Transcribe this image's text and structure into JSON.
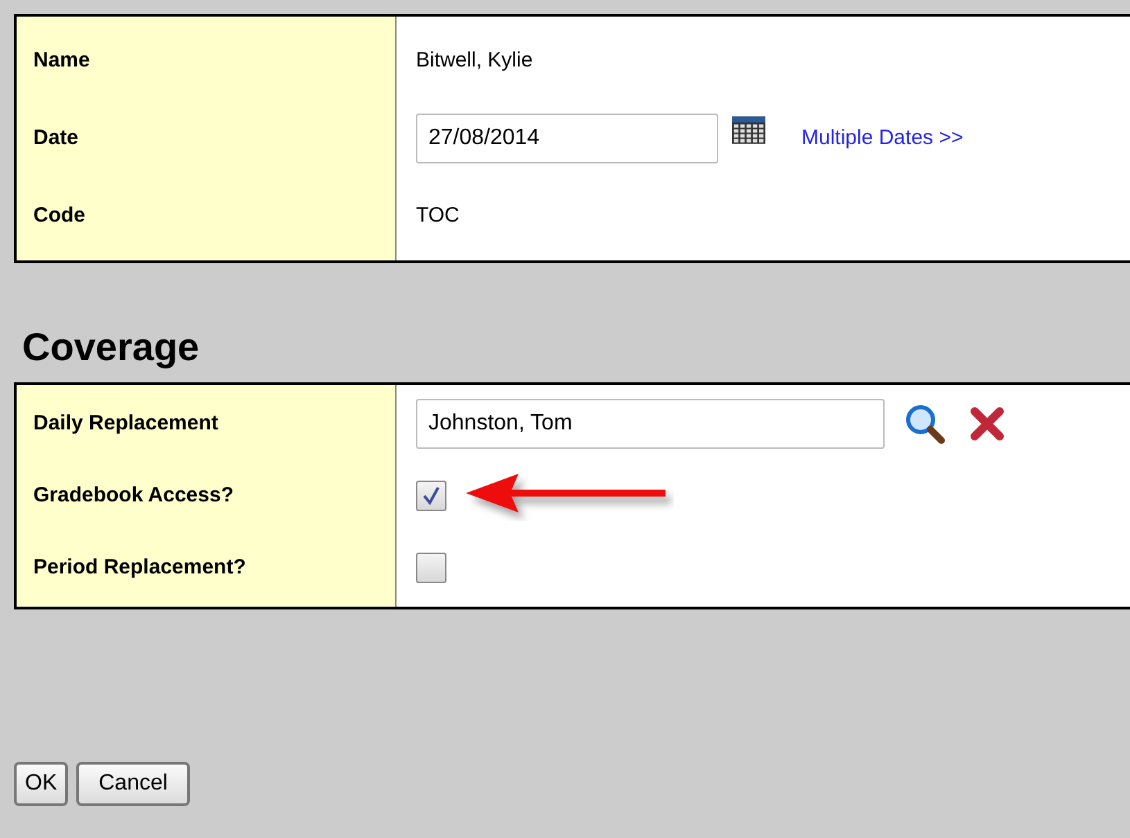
{
  "details": {
    "rows": [
      {
        "kind": "text",
        "label": "Name",
        "value": "Bitwell, Kylie"
      },
      {
        "kind": "date",
        "label": "Date",
        "value": "27/08/2014",
        "link": "Multiple Dates >>"
      },
      {
        "kind": "text",
        "label": "Code",
        "value": "TOC"
      }
    ]
  },
  "coverage": {
    "title": "Coverage",
    "rows": [
      {
        "kind": "lookup",
        "label": "Daily Replacement",
        "value": "Johnston, Tom"
      },
      {
        "kind": "checkbox",
        "label": "Gradebook Access?",
        "checked": true
      },
      {
        "kind": "checkbox",
        "label": "Period Replacement?",
        "checked": false
      }
    ]
  },
  "buttons": [
    "OK",
    "Cancel"
  ]
}
